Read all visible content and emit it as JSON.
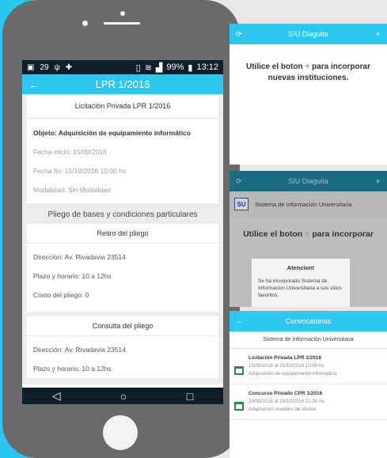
{
  "phone": {
    "status": {
      "left_icons": [
        "▣",
        "29",
        "ψ",
        "✚"
      ],
      "battery": "99%",
      "time": "13:12"
    },
    "appbar": {
      "title": "LPR 1/2016"
    },
    "card": {
      "header": "Licitación Privada LPR 1/2016",
      "objeto": "Objeto: Adquisición de equipamiento informático",
      "fecha_inicio": "Fecha inicio: 15/09/2016",
      "fecha_fin": "Fecha fin: 15/10/2016 10:00 hs",
      "modalidad": "Modalidad: Sin Modalidad"
    },
    "pliego": {
      "title": "Pliego de bases y condiciones particulares",
      "retiro": {
        "title": "Retiro del pliego",
        "direccion": "Dirección: Av. Rivadavia 23514",
        "plazo": "Plazo y horario: 10 a 12hs",
        "costo": "Costo del pliego: 0"
      },
      "consulta": {
        "title": "Consulta del pliego",
        "direccion": "Dirección: Av. Rivadavia 23514",
        "plazo": "Plazo y horario: 10 a 12hs"
      }
    }
  },
  "panel1": {
    "title": "SIU Diaguita",
    "msg_pre": "Utilice el boton",
    "msg_plus": "+",
    "msg_post": "para incorporar nuevas instituciones."
  },
  "panel2": {
    "title": "SIU Diaguita",
    "logo": "SU",
    "institution": "Sistema de Información Universitaria",
    "msg_pre": "Utilice el boton",
    "msg_plus": "+",
    "msg_post": "para incorporar",
    "dialog": {
      "title": "Atencion!",
      "body": "Se ha incorporado Sistema de Informacion Universitaria a sus sitios favoritos."
    }
  },
  "panel3": {
    "title": "Convocatorias",
    "institution": "Sistema de Información Universitaria",
    "items": [
      {
        "title": "Licitación Privada LPR 1/2016",
        "dates": "15/09/2016 al 15/10/2016 10:00 hs",
        "desc": "Adquisición de equipamiento informático"
      },
      {
        "title": "Concurso Privado CPR 1/2016",
        "dates": "20/09/2016 al 20/10/2016 22:00 hs",
        "desc": "Adquisicion muebles de oficina"
      }
    ]
  }
}
